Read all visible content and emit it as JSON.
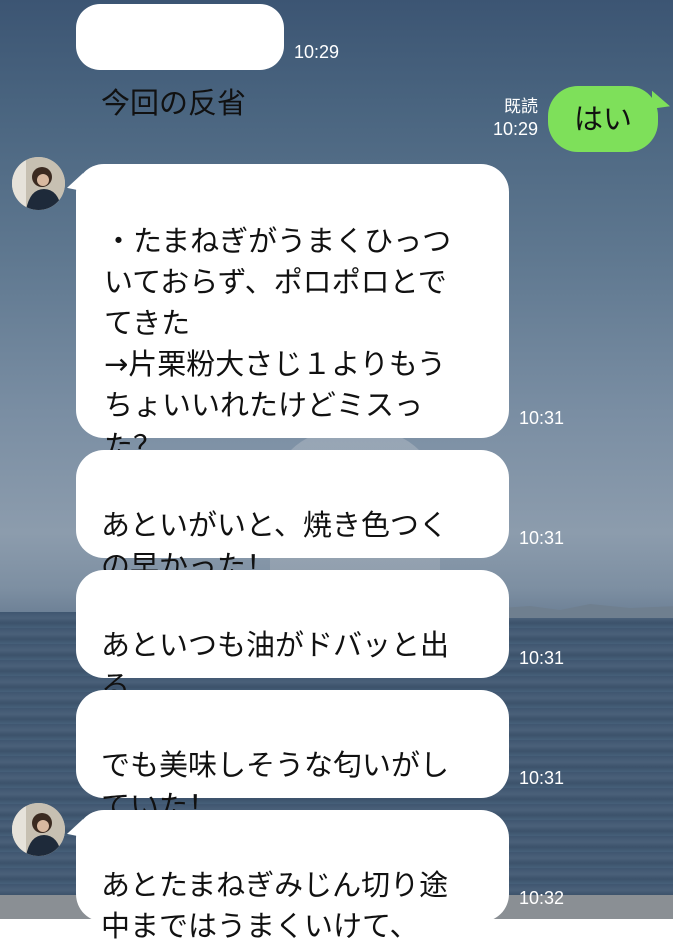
{
  "messages": [
    {
      "id": "m1",
      "side": "left",
      "text": "今回の反省",
      "time": "10:29"
    },
    {
      "id": "m2",
      "side": "right",
      "text": "はい",
      "time": "10:29",
      "read": "既読"
    },
    {
      "id": "m3",
      "side": "left",
      "text": "・たまねぎがうまくひっつ\nいておらず、ポロポロとで\nてきた\n→片栗粉大さじ１よりもう\nちょいいれたけどミスっ\nた？",
      "time": "10:31"
    },
    {
      "id": "m4",
      "side": "left",
      "text": "あといがいと、焼き色つく\nの早かった！",
      "time": "10:31"
    },
    {
      "id": "m5",
      "side": "left",
      "text": "あといつも油がドバッと出\nる",
      "time": "10:31"
    },
    {
      "id": "m6",
      "side": "left",
      "text": "でも美味しそうな匂いがし\nていた！",
      "time": "10:31"
    },
    {
      "id": "m7",
      "side": "left",
      "text": "あとたまねぎみじん切り途\n中まではうまくいけて、",
      "time": "10:32"
    }
  ],
  "colors": {
    "my_bubble": "#7ee05a",
    "their_bubble": "#ffffff",
    "meta_text": "#ffffff"
  },
  "icons": {
    "avatar": "contact-avatar-icon"
  }
}
